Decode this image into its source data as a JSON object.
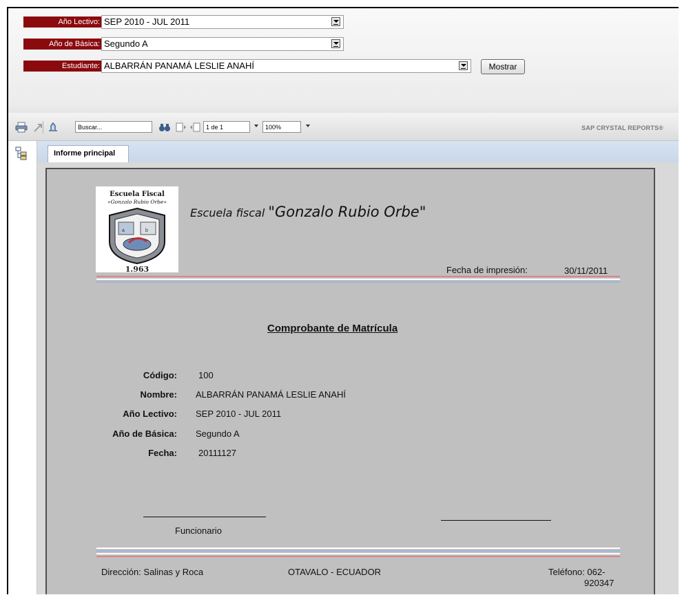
{
  "params": {
    "ano_lectivo": {
      "label": "Año Lectivo:",
      "value": "SEP 2010 - JUL 2011"
    },
    "ano_basica": {
      "label": "Año de Básica:",
      "value": "Segundo A"
    },
    "estudiante": {
      "label": "Estudiante:",
      "value": "ALBARRÁN PANAMÁ LESLIE ANAHÍ"
    },
    "mostrar_label": "Mostrar"
  },
  "toolbar": {
    "search_value": "Buscar...",
    "page_value": "1 de 1",
    "zoom_value": "100%",
    "brand": "SAP CRYSTAL REPORTS®",
    "icons": [
      "printer-icon",
      "export-icon",
      "refresh-icon",
      "binoculars-icon",
      "first-page-icon",
      "previous-page-icon"
    ]
  },
  "sidebar": {
    "icon": "group-tree-icon"
  },
  "tabs": {
    "main_label": "Informe principal"
  },
  "report": {
    "logo": {
      "line1": "Escuela Fiscal",
      "line2": "«Gonzalo Rubio Orbe»",
      "year": "1.963"
    },
    "title_lead": "Escuela fiscal ",
    "title_main": "\"Gonzalo Rubio Orbe\"",
    "print_date_label": "Fecha de impresión:",
    "print_date_value": "30/11/2011",
    "heading": "Comprobante de Matrícula",
    "fields": {
      "codigo": {
        "label": "Código:",
        "value": "100"
      },
      "nombre": {
        "label": "Nombre:",
        "value": "ALBARRÁN PANAMÁ LESLIE ANAHÍ"
      },
      "ano_lectivo": {
        "label": "Año Lectivo:",
        "value": "SEP 2010 - JUL 2011"
      },
      "ano_basica": {
        "label": "Año de Básica:",
        "value": "Segundo A"
      },
      "fecha": {
        "label": "Fecha:",
        "value": "20111127"
      }
    },
    "signature_label": "Funcionario",
    "footer": {
      "address": "Dirección: Salinas y Roca",
      "city": "OTAVALO - ECUADOR",
      "phone_line1": "Teléfono: 062-",
      "phone_line2": "920347"
    },
    "colors": {
      "stripe_red": "#d9868a",
      "stripe_blue": "#9fb3d6",
      "label_bg": "#8b0a0e"
    }
  }
}
